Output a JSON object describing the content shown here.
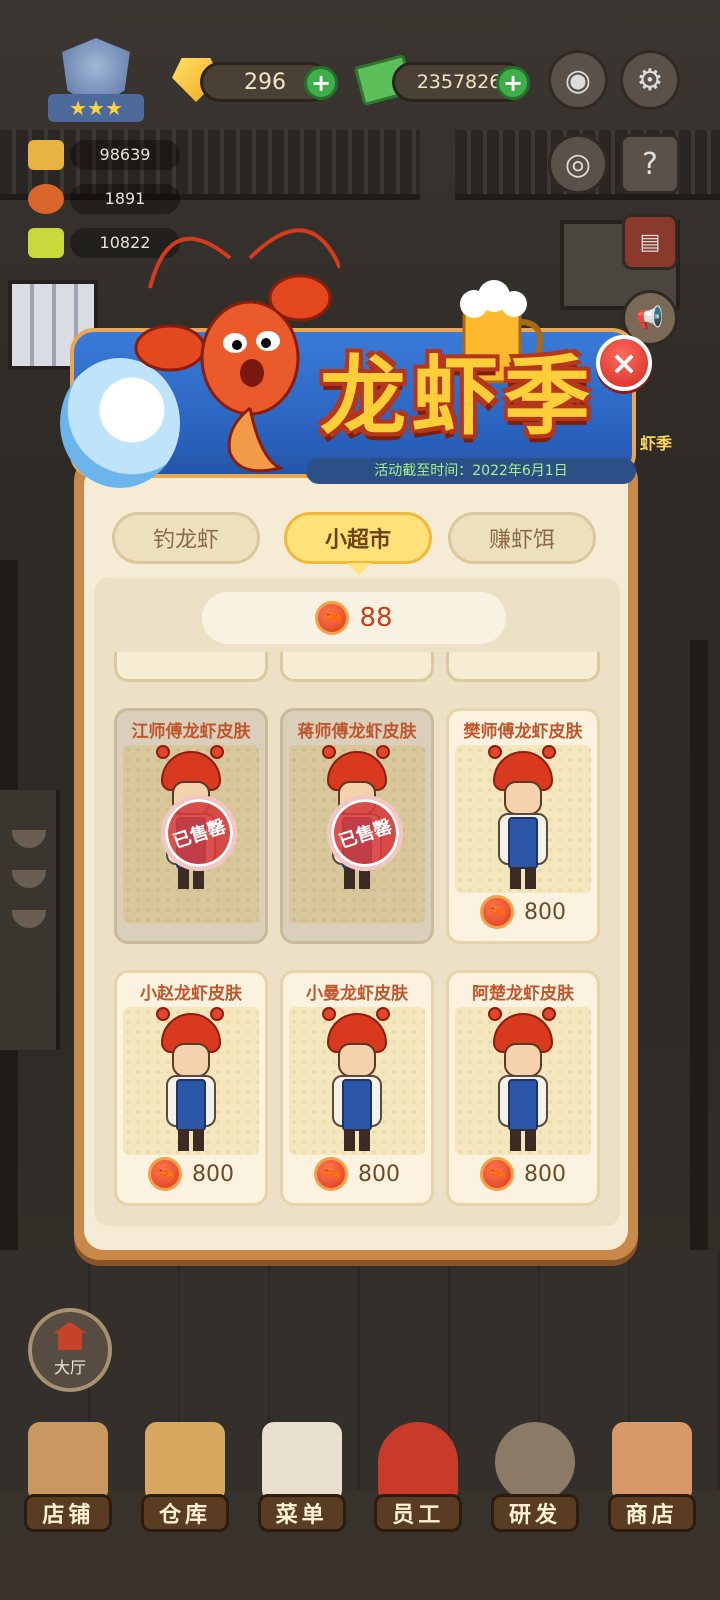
{
  "hud": {
    "gems": "296",
    "cash": "2357826",
    "stats": [
      "98639",
      "1891",
      "10822"
    ]
  },
  "side_label": "虾季",
  "event": {
    "title": "龙虾季",
    "deadline": "活动截至时间：2022年6月1日",
    "close_icon": "×"
  },
  "tabs": [
    {
      "label": "钓龙虾",
      "active": false
    },
    {
      "label": "小超市",
      "active": true
    },
    {
      "label": "赚虾饵",
      "active": false
    }
  ],
  "balance": "88",
  "shop_items": [
    {
      "name": "江师傅龙虾皮肤",
      "price": "",
      "sold": true,
      "stamp": "已售罄"
    },
    {
      "name": "蒋师傅龙虾皮肤",
      "price": "",
      "sold": true,
      "stamp": "已售罄"
    },
    {
      "name": "樊师傅龙虾皮肤",
      "price": "800",
      "sold": false
    },
    {
      "name": "小赵龙虾皮肤",
      "price": "800",
      "sold": false
    },
    {
      "name": "小曼龙虾皮肤",
      "price": "800",
      "sold": false
    },
    {
      "name": "阿楚龙虾皮肤",
      "price": "800",
      "sold": false
    }
  ],
  "hall_button": "大厅",
  "bottom_nav": [
    "店铺",
    "仓库",
    "菜单",
    "员工",
    "研发",
    "商店"
  ],
  "colors": {
    "modal_border": "#c9894b",
    "modal_bg": "#f6ecd6",
    "active_tab": "#ffe27a",
    "title_fill": "#ffcf3a",
    "close_button": "#d02a22"
  }
}
